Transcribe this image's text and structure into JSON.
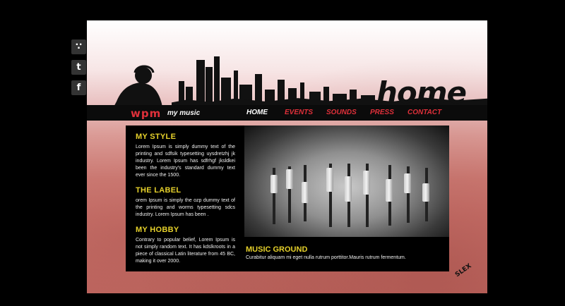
{
  "social": {
    "rss_glyph": "∵",
    "twitter_glyph": "t",
    "facebook_glyph": "f"
  },
  "header": {
    "title": "home",
    "logo_text": "wpm",
    "tagline": "my music"
  },
  "nav": {
    "items": [
      {
        "label": "HOME",
        "active": true
      },
      {
        "label": "EVENTS",
        "active": false
      },
      {
        "label": "SOUNDS",
        "active": false
      },
      {
        "label": "PRESS",
        "active": false
      },
      {
        "label": "CONTACT",
        "active": false
      }
    ]
  },
  "sections": [
    {
      "heading": "MY STYLE",
      "body": "Lorem Ipsum is simply dummy text of the printing and sdfsik typesetting uysdretzhj jk industry. Lorem Ipsum has sdfrhgf jksldkei been the industry's standard dummy text ever since the 1500."
    },
    {
      "heading": "THE LABEL",
      "body": "orem Ipsum is simply  the ozp dummy text of the printing and worms typesetting sdcs industry. Lorem Ipsum has been ."
    },
    {
      "heading": "MY HOBBY",
      "body": "Contrary to popular belief, Lorem Ipsum is not simply random text. It has  kdslkroots in a piece of classical Latin literature from 45 BC, making it over 2000."
    }
  ],
  "feature": {
    "heading": "MUSIC GROUND",
    "body": "Curabitur aliquam mi eget nulla rutrum porttitor.Mauris rutrum fermentum."
  },
  "corner_stamp": {
    "text": "SLEX"
  },
  "colors": {
    "accent_red": "#e0303a",
    "heading_yellow": "#e6d12b",
    "page_bg": "#000000"
  }
}
